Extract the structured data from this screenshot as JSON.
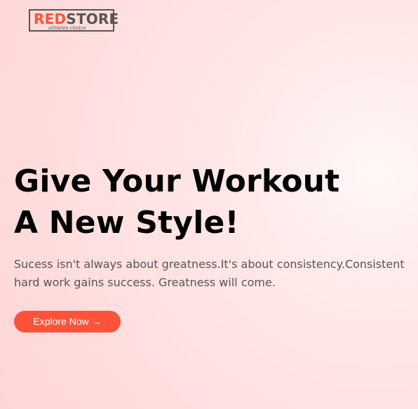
{
  "logo": {
    "brand_red": "RED",
    "brand_dark": "STORE",
    "tagline": "athletes choice",
    "brand_color": "#ff523b"
  },
  "hero": {
    "title_line_1": "Give Your Workout",
    "title_line_2": "A New Style!",
    "description": "Sucess isn't always about greatness.It's about consistency.Consistent hard work gains success. Greatness will come.",
    "cta_label": "Explore Now →",
    "cta_color": "#ff523b"
  }
}
